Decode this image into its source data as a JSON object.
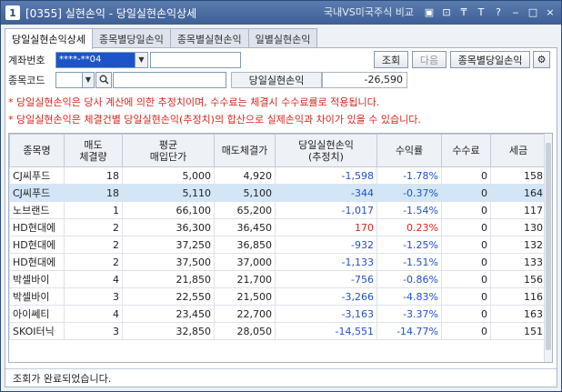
{
  "titlebar": {
    "window_number": "1",
    "title": "[0355] 실현손익 - 당일실현손익상세",
    "compare_link": "국내VS미국주식 비교",
    "buttons": [
      "▣",
      "⊡",
      "₸",
      "T",
      "?",
      "‒",
      "□",
      "×"
    ]
  },
  "tabs": [
    {
      "label": "당일실현손익상세",
      "active": true
    },
    {
      "label": "종목별당일손익",
      "active": false
    },
    {
      "label": "종목별실현손익",
      "active": false
    },
    {
      "label": "일별실현손익",
      "active": false
    }
  ],
  "form": {
    "account_label": "계좌번호",
    "account_value": "****-**04",
    "query_button": "조회",
    "next_button": "다음",
    "by_stock_button": "종목별당일손익",
    "code_label": "종목코드",
    "pnl_label": "당일실현손익",
    "pnl_value": "-26,590"
  },
  "notices": [
    "* 당일실현손익은 당사 계산에 의한 추정치이며, 수수료는 체결시 수수료률로 적용됩니다.",
    "* 당일실현손익은 체결건별 당일실현손익(추정치)의 합산으로 실제손익과 차이가 있을 수 있습니다."
  ],
  "table": {
    "headers": [
      {
        "line1": "종목명",
        "line2": ""
      },
      {
        "line1": "매도",
        "line2": "체결량"
      },
      {
        "line1": "평균",
        "line2": "매입단가"
      },
      {
        "line1": "매도체결가",
        "line2": ""
      },
      {
        "line1": "당일실현손익",
        "line2": "(추정치)"
      },
      {
        "line1": "수익률",
        "line2": ""
      },
      {
        "line1": "수수료",
        "line2": ""
      },
      {
        "line1": "세금",
        "line2": ""
      }
    ],
    "rows": [
      {
        "name": "CJ씨푸드",
        "qty": "18",
        "avg": "5,000",
        "price": "4,920",
        "pnl": "-1,598",
        "rate": "-1.78%",
        "fee": "0",
        "tax": "158",
        "sign": "neg",
        "selected": false
      },
      {
        "name": "CJ씨푸드",
        "qty": "18",
        "avg": "5,110",
        "price": "5,100",
        "pnl": "-344",
        "rate": "-0.37%",
        "fee": "0",
        "tax": "164",
        "sign": "neg",
        "selected": true
      },
      {
        "name": "노브랜드",
        "qty": "1",
        "avg": "66,100",
        "price": "65,200",
        "pnl": "-1,017",
        "rate": "-1.54%",
        "fee": "0",
        "tax": "117",
        "sign": "neg",
        "selected": false
      },
      {
        "name": "HD현대에",
        "qty": "2",
        "avg": "36,300",
        "price": "36,450",
        "pnl": "170",
        "rate": "0.23%",
        "fee": "0",
        "tax": "130",
        "sign": "pos",
        "selected": false
      },
      {
        "name": "HD현대에",
        "qty": "2",
        "avg": "37,250",
        "price": "36,850",
        "pnl": "-932",
        "rate": "-1.25%",
        "fee": "0",
        "tax": "132",
        "sign": "neg",
        "selected": false
      },
      {
        "name": "HD현대에",
        "qty": "2",
        "avg": "37,500",
        "price": "37,000",
        "pnl": "-1,133",
        "rate": "-1.51%",
        "fee": "0",
        "tax": "133",
        "sign": "neg",
        "selected": false
      },
      {
        "name": "박셀바이",
        "qty": "4",
        "avg": "21,850",
        "price": "21,700",
        "pnl": "-756",
        "rate": "-0.86%",
        "fee": "0",
        "tax": "156",
        "sign": "neg",
        "selected": false
      },
      {
        "name": "박셀바이",
        "qty": "3",
        "avg": "22,550",
        "price": "21,500",
        "pnl": "-3,266",
        "rate": "-4.83%",
        "fee": "0",
        "tax": "116",
        "sign": "neg",
        "selected": false
      },
      {
        "name": "아이쎄티",
        "qty": "4",
        "avg": "23,450",
        "price": "22,700",
        "pnl": "-3,163",
        "rate": "-3.37%",
        "fee": "0",
        "tax": "163",
        "sign": "neg",
        "selected": false
      },
      {
        "name": "SKOI터닉",
        "qty": "3",
        "avg": "32,850",
        "price": "28,050",
        "pnl": "-14,551",
        "rate": "-14.77%",
        "fee": "0",
        "tax": "151",
        "sign": "neg",
        "selected": false
      }
    ]
  },
  "status": "조회가 완료되었습니다."
}
